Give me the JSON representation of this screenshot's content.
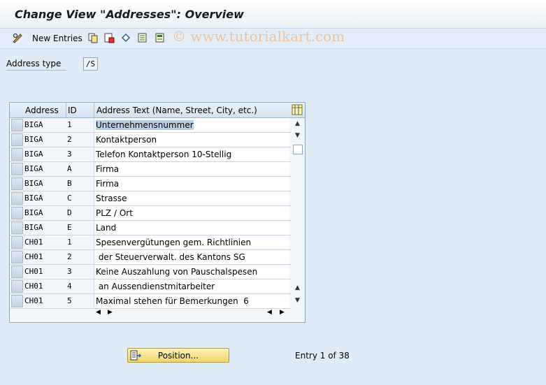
{
  "window": {
    "title": "Change View \"Addresses\": Overview"
  },
  "toolbar": {
    "new_entries_label": "New Entries",
    "icons": [
      "pencil-glasses-icon",
      "copy-icon",
      "delete-icon",
      "undo-icon",
      "select-all-icon",
      "deselect-icon"
    ]
  },
  "watermark": "© www.tutorialkart.com",
  "filter": {
    "label": "Address type",
    "value": "/S"
  },
  "table": {
    "columns": [
      "Address",
      "ID",
      "Address Text (Name, Street, City, etc.)"
    ],
    "rows": [
      {
        "address": "BIGA",
        "id": "1",
        "text": "Unternehmensnummer"
      },
      {
        "address": "BIGA",
        "id": "2",
        "text": "Kontaktperson"
      },
      {
        "address": "BIGA",
        "id": "3",
        "text": "Telefon Kontaktperson 10-Stellig"
      },
      {
        "address": "BIGA",
        "id": "A",
        "text": "Firma"
      },
      {
        "address": "BIGA",
        "id": "B",
        "text": "Firma"
      },
      {
        "address": "BIGA",
        "id": "C",
        "text": "Strasse"
      },
      {
        "address": "BIGA",
        "id": "D",
        "text": "PLZ / Ort"
      },
      {
        "address": "BIGA",
        "id": "E",
        "text": "Land"
      },
      {
        "address": "CH01",
        "id": "1",
        "text": "Spesenvergütungen gem. Richtlinien"
      },
      {
        "address": "CH01",
        "id": "2",
        "text": " der Steuerverwalt. des Kantons SG"
      },
      {
        "address": "CH01",
        "id": "3",
        "text": "Keine Auszahlung von Pauschalspesen"
      },
      {
        "address": "CH01",
        "id": "4",
        "text": " an Aussendienstmitarbeiter"
      },
      {
        "address": "CH01",
        "id": "5",
        "text": "Maximal stehen für Bemerkungen  6"
      }
    ]
  },
  "footer": {
    "position_label": "Position...",
    "entry_text": "Entry 1 of 38"
  },
  "colors": {
    "background": "#dfebf5",
    "button": "#f1d56a",
    "selection": "#b9cfe4",
    "watermark": "#f0b37a"
  }
}
